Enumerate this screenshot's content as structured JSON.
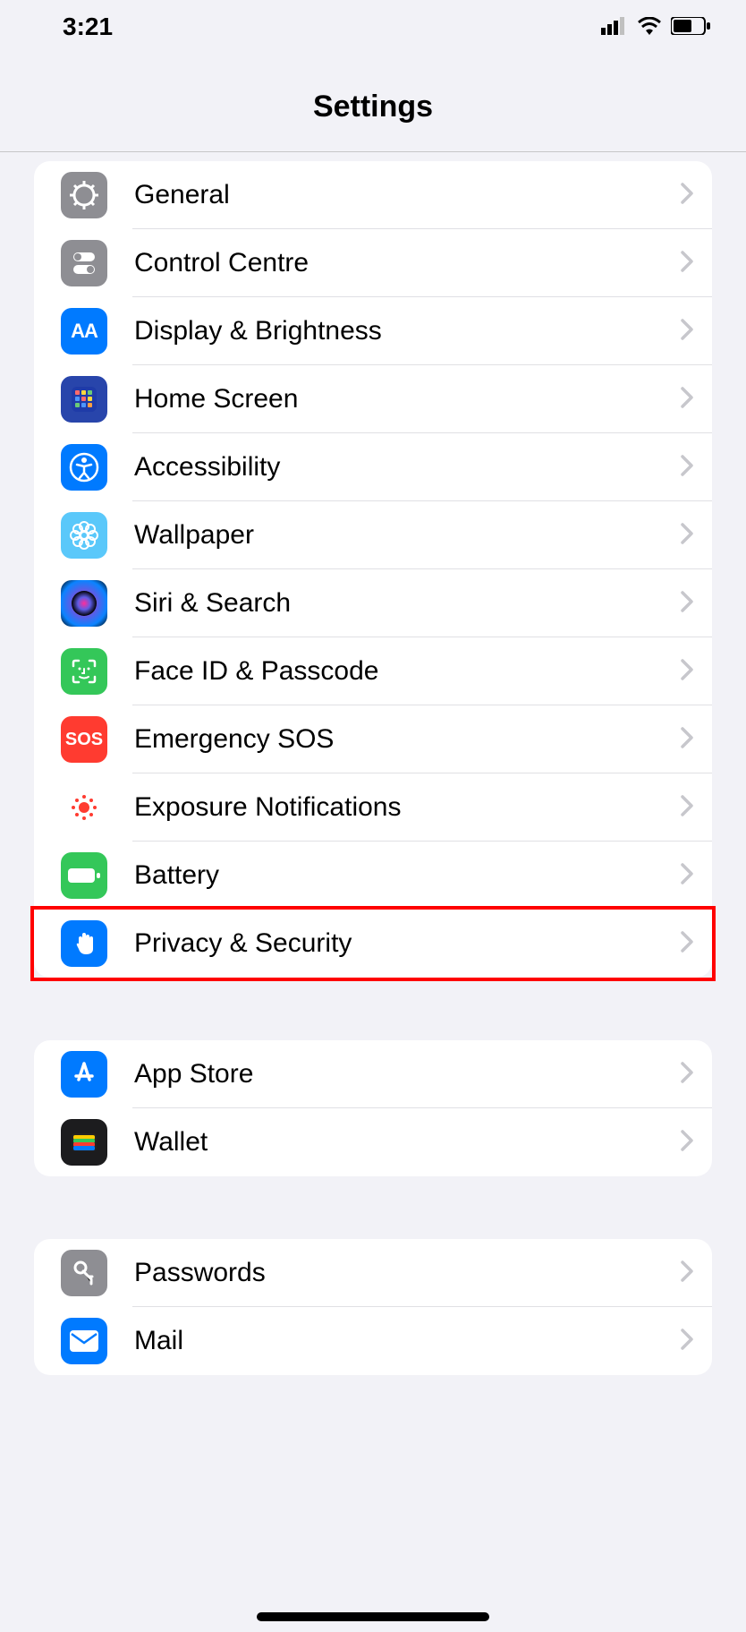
{
  "status": {
    "time": "3:21"
  },
  "header": {
    "title": "Settings"
  },
  "sections": [
    {
      "rows": [
        {
          "id": "general",
          "icon": "gear-icon",
          "bg": "bg-gray",
          "label": "General"
        },
        {
          "id": "control-centre",
          "icon": "switches-icon",
          "bg": "bg-gray",
          "label": "Control Centre"
        },
        {
          "id": "display-brightness",
          "icon": "aa-icon",
          "bg": "bg-blue",
          "label": "Display & Brightness"
        },
        {
          "id": "home-screen",
          "icon": "grid-icon",
          "bg": "bg-darkblue",
          "label": "Home Screen"
        },
        {
          "id": "accessibility",
          "icon": "accessibility-icon",
          "bg": "bg-blue",
          "label": "Accessibility"
        },
        {
          "id": "wallpaper",
          "icon": "flower-icon",
          "bg": "bg-cyan",
          "label": "Wallpaper"
        },
        {
          "id": "siri-search",
          "icon": "siri-icon",
          "bg": "bg-siri",
          "label": "Siri & Search"
        },
        {
          "id": "faceid",
          "icon": "faceid-icon",
          "bg": "bg-green",
          "label": "Face ID & Passcode"
        },
        {
          "id": "sos",
          "icon": "sos-icon",
          "bg": "bg-red",
          "label": "Emergency SOS"
        },
        {
          "id": "exposure",
          "icon": "exposure-icon",
          "bg": "bg-white",
          "label": "Exposure Notifications"
        },
        {
          "id": "battery",
          "icon": "battery-icon",
          "bg": "bg-green",
          "label": "Battery"
        },
        {
          "id": "privacy",
          "icon": "hand-icon",
          "bg": "bg-blue",
          "label": "Privacy & Security",
          "highlight": true
        }
      ]
    },
    {
      "rows": [
        {
          "id": "app-store",
          "icon": "appstore-icon",
          "bg": "bg-blue",
          "label": "App Store"
        },
        {
          "id": "wallet",
          "icon": "wallet-icon",
          "bg": "bg-black",
          "label": "Wallet"
        }
      ]
    },
    {
      "rows": [
        {
          "id": "passwords",
          "icon": "key-icon",
          "bg": "bg-gray",
          "label": "Passwords"
        },
        {
          "id": "mail",
          "icon": "mail-icon",
          "bg": "bg-blue",
          "label": "Mail"
        }
      ]
    }
  ]
}
